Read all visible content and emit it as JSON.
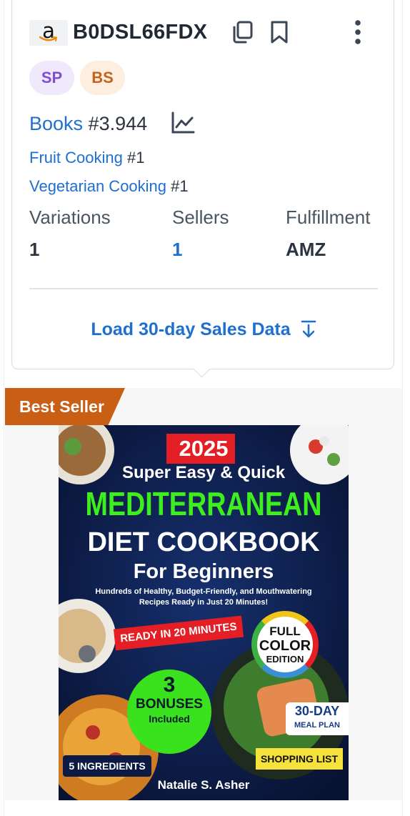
{
  "product": {
    "asin": "B0DSL66FDX",
    "marketplace_icon": "amazon-logo",
    "badges": [
      {
        "label": "SP",
        "color": "#7f4fd0",
        "bg": "#efe9fb"
      },
      {
        "label": "BS",
        "color": "#c4631a",
        "bg": "#fdeee0"
      }
    ]
  },
  "ranks": {
    "main": {
      "category": "Books",
      "rank": "#3.944"
    },
    "sub": [
      {
        "category": "Fruit Cooking",
        "rank": "#1"
      },
      {
        "category": "Vegetarian Cooking",
        "rank": "#1"
      }
    ]
  },
  "stats": [
    {
      "label": "Variations",
      "value": "1"
    },
    {
      "label": "Sellers",
      "value": "1"
    },
    {
      "label": "Fulfillment",
      "value": "AMZ"
    }
  ],
  "actions": {
    "load_sales_label": "Load 30-day Sales Data"
  },
  "listing": {
    "badge": "Best Seller",
    "cover": {
      "year": "2025",
      "line1": "Super Easy & Quick",
      "line2": "MEDITERRANEAN",
      "line3": "DIET COOKBOOK",
      "line4": "For Beginners",
      "blurb1": "Hundreds of Healthy, Budget-Friendly, and Mouthwatering",
      "blurb2": "Recipes Ready in Just 20 Minutes!",
      "ready": "READY IN 20 MINUTES",
      "full1": "FULL",
      "full2": "COLOR",
      "full3": "EDITION",
      "bonus_num": "3",
      "bonus1": "BONUSES",
      "bonus2": "Included",
      "plan1": "30-DAY",
      "plan2": "MEAL PLAN",
      "ingredients": "5 INGREDIENTS",
      "shopping": "SHOPPING LIST",
      "author": "Natalie S. Asher"
    }
  },
  "colors": {
    "accent": "#1f6fd1",
    "best_seller": "#c85f14",
    "text": "#2b3440"
  }
}
